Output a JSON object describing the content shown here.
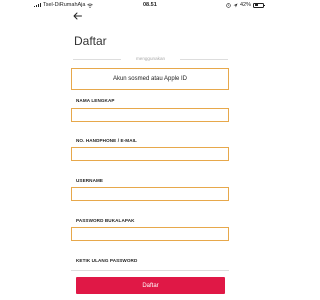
{
  "status_bar": {
    "carrier": "Tsel-DiRumahAja",
    "time": "08.51",
    "battery": "42%",
    "battery_level": 0.42
  },
  "header": {
    "back_icon": "arrow-left-icon",
    "title": "Daftar"
  },
  "divider_text": "menggunakan",
  "social_button_label": "Akun sosmed atau Apple ID",
  "form": {
    "fields": [
      {
        "label": "NAMA LENGKAP",
        "value": ""
      },
      {
        "label": "NO. HANDPHONE / E-MAIL",
        "value": ""
      },
      {
        "label": "USERNAME",
        "value": ""
      },
      {
        "label": "PASSWORD BUKALAPAK",
        "value": ""
      },
      {
        "label": "KETIK ULANG PASSWORD",
        "value": ""
      }
    ],
    "submit_label": "Daftar"
  },
  "colors": {
    "accent": "#e01846",
    "focus_border": "#e7a84b"
  }
}
